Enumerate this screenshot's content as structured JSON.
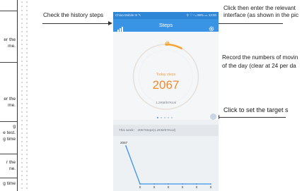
{
  "left_table": {
    "fragments": [
      "er the",
      "me.",
      "er the",
      "me.",
      "g",
      "e test.",
      "g time",
      "r the",
      "ne.",
      "g time"
    ]
  },
  "annotations": {
    "history": "Check the history steps",
    "interface_line1": "Click then enter the relevant",
    "interface_line2": "interface (as shown in the pic",
    "record_line1": "Record the numbers of movin",
    "record_line2": "of the day (clear at 24 per da",
    "target": "Click to set the target s"
  },
  "phone": {
    "status_left": "China Mobile ✉ ✎",
    "status_right": "⚲ ♡ ⁿ ᵢₗ 99% ▭ 13:00",
    "title": "Steps",
    "ring_label": "Today steps",
    "steps": "2067",
    "ring_sub": "1.2KM/57Kcal",
    "week_summary": "This week： 2067Steps(1.2KM/57Kcal)",
    "graph_peak_label": "2067",
    "graph_zero_labels": [
      "0",
      "0",
      "0",
      "0",
      "0",
      "0"
    ],
    "pager_dots": 5,
    "progress_fraction": 0.08,
    "colors": {
      "primary": "#3a94e6",
      "ring": "#f5a533",
      "steps_text": "#f08a2c"
    }
  },
  "chart_data": {
    "type": "line",
    "x": [
      1,
      2,
      3,
      4,
      5,
      6,
      7
    ],
    "values": [
      2067,
      0,
      0,
      0,
      0,
      0,
      0
    ],
    "title": "",
    "xlabel": "",
    "ylabel": "",
    "ylim": [
      0,
      2067
    ]
  }
}
